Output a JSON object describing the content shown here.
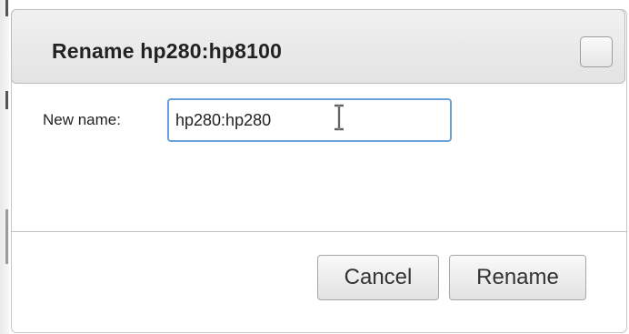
{
  "dialog": {
    "title": "Rename hp280:hp8100",
    "field_label": "New name:",
    "input_value": "hp280:hp280",
    "buttons": {
      "cancel_label": "Cancel",
      "rename_label": "Rename"
    }
  },
  "icons": {
    "close": "close-icon",
    "text_cursor": "text-cursor-icon"
  },
  "colors": {
    "input_focus_border": "#6aa0d8",
    "titlebar_top": "#f1f1f1",
    "titlebar_bottom": "#e3e3e3"
  }
}
